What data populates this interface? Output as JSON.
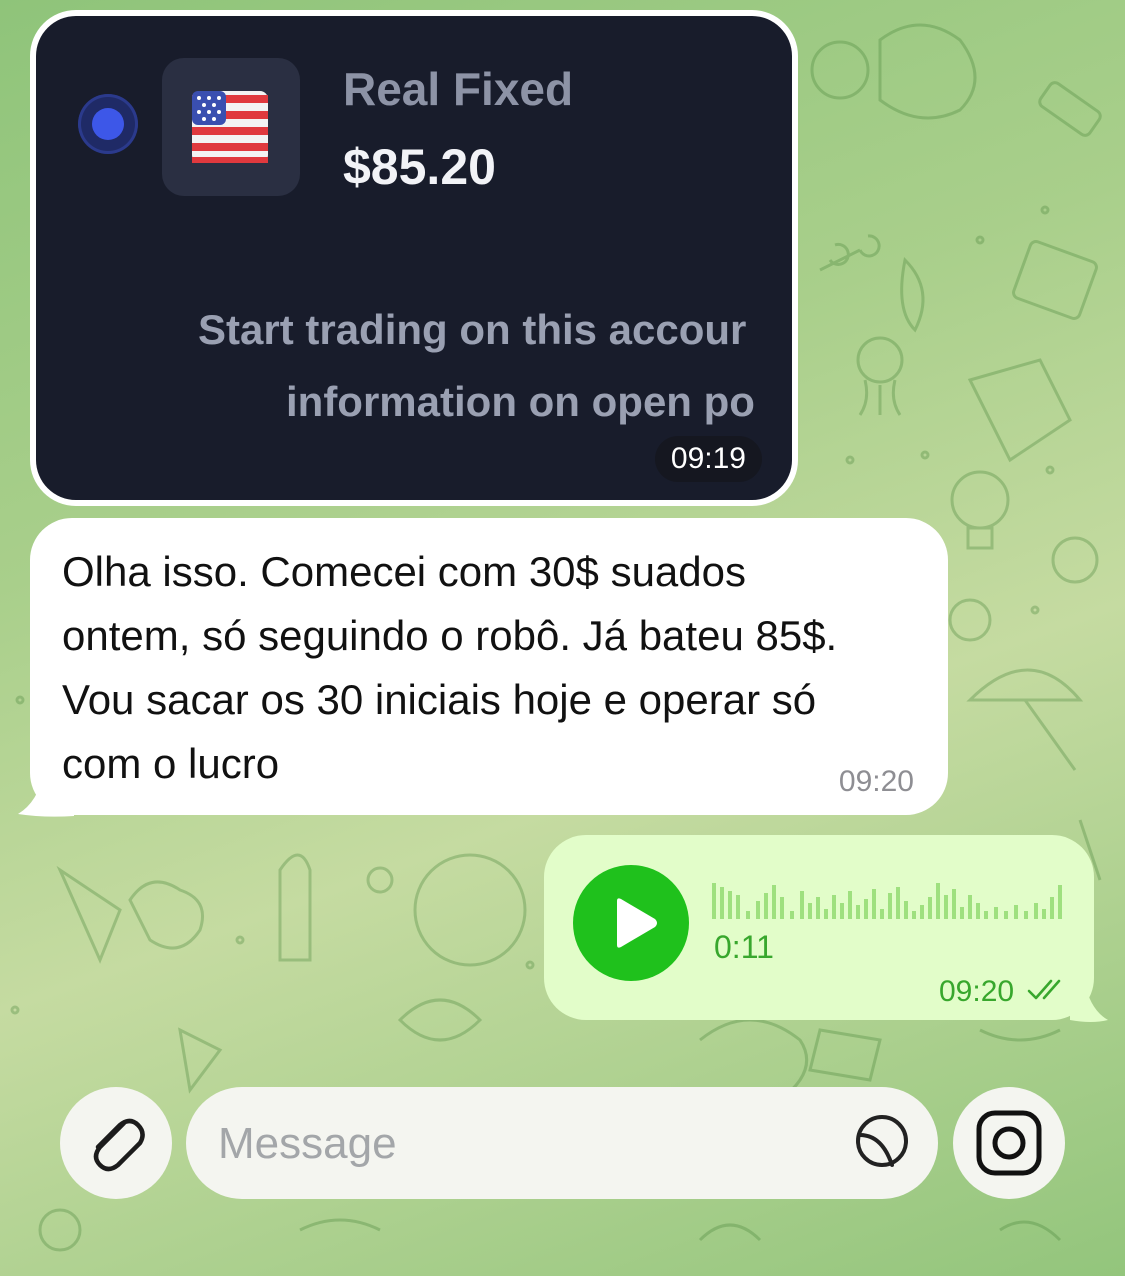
{
  "chat": {
    "image_message": {
      "account_name": "Real Fixed",
      "account_balance": "$85.20",
      "trade_line_1": "Start trading on this accour",
      "trade_line_2": "information on open po",
      "time": "09:19"
    },
    "text_message": {
      "line1": "Olha isso. Comecei com 30$ suados",
      "line2": "ontem, só seguindo o robô. Já bateu 85$.",
      "line3": "Vou sacar os 30 iniciais hoje e operar só",
      "line4": "com o lucro",
      "time": "09:20"
    },
    "voice_message": {
      "duration": "0:11",
      "time": "09:20",
      "status": "read"
    }
  },
  "input_bar": {
    "placeholder": "Message"
  },
  "icons": {
    "attach": "paperclip-icon",
    "sticker": "sticker-icon",
    "camera": "camera-icon",
    "play": "play-icon",
    "read": "double-check-icon",
    "flag": "us-flag-icon"
  },
  "colors": {
    "incoming_bubble": "#ffffff",
    "outgoing_bubble": "#e2fdc9",
    "accent_green": "#1fc11c",
    "outgoing_text": "#38a72d",
    "screenshot_bg": "#181c2b",
    "radio_blue": "#3d57e8"
  }
}
